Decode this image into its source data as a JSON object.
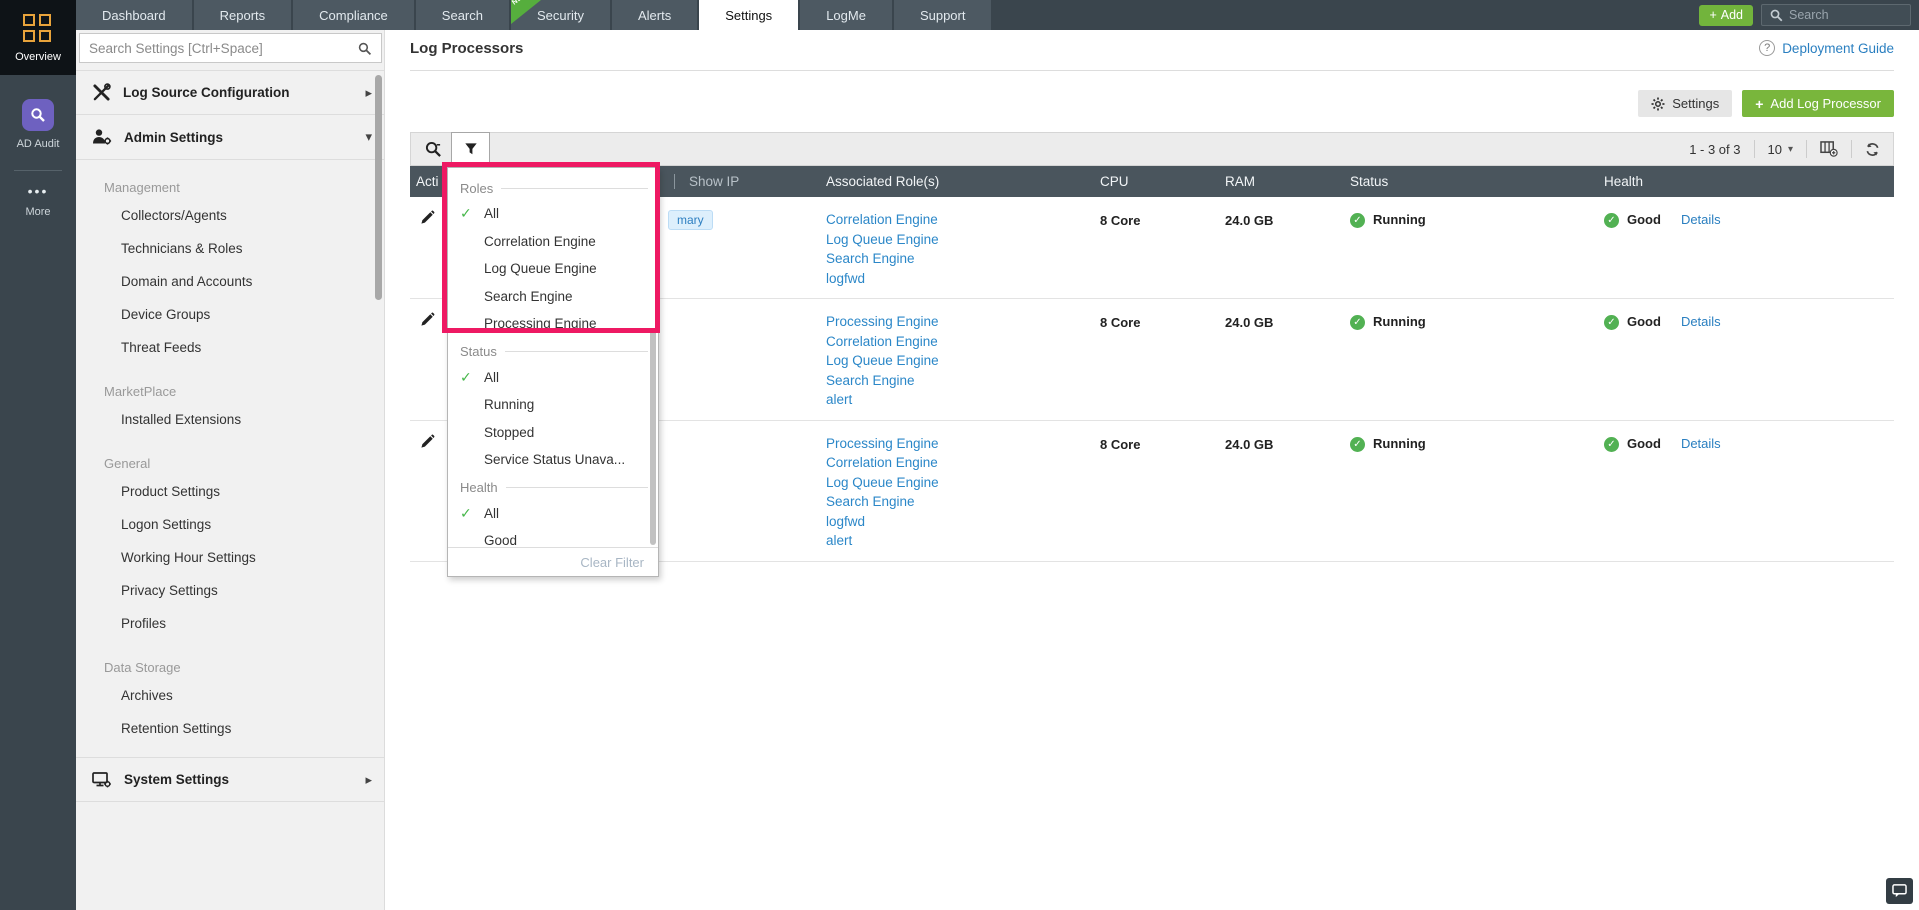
{
  "colors": {
    "accent_green": "#72b43c",
    "link_blue": "#2a7fc0",
    "annotation_pink": "#ee1963",
    "status_green": "#52b153",
    "header_slate": "#4a555d"
  },
  "nav": {
    "tabs": [
      {
        "label": "Dashboard",
        "active": false,
        "badge": ""
      },
      {
        "label": "Reports",
        "active": false,
        "badge": ""
      },
      {
        "label": "Compliance",
        "active": false,
        "badge": ""
      },
      {
        "label": "Search",
        "active": false,
        "badge": ""
      },
      {
        "label": "Security",
        "active": false,
        "badge": "NEW"
      },
      {
        "label": "Alerts",
        "active": false,
        "badge": ""
      },
      {
        "label": "Settings",
        "active": true,
        "badge": ""
      },
      {
        "label": "LogMe",
        "active": false,
        "badge": ""
      },
      {
        "label": "Support",
        "active": false,
        "badge": ""
      }
    ],
    "add_button_label": "Add",
    "add_button_plus": "+",
    "search_placeholder": "Search"
  },
  "rail": {
    "overview_label": "Overview",
    "ad_audit_label": "AD Audit",
    "more_label": "More",
    "more_dots": "•••"
  },
  "sidebar": {
    "search_placeholder": "Search Settings [Ctrl+Space]",
    "log_source_config_label": "Log Source Configuration",
    "admin_settings_label": "Admin Settings",
    "chevron_right": "▸",
    "chevron_down": "▾",
    "sections": [
      {
        "title": "Management",
        "items": [
          "Collectors/Agents",
          "Technicians & Roles",
          "Domain and Accounts",
          "Device Groups",
          "Threat Feeds"
        ]
      },
      {
        "title": "MarketPlace",
        "items": [
          "Installed Extensions"
        ]
      },
      {
        "title": "General",
        "items": [
          "Product Settings",
          "Logon Settings",
          "Working Hour Settings",
          "Privacy Settings",
          "Profiles"
        ]
      },
      {
        "title": "Data Storage",
        "items": [
          "Archives",
          "Retention Settings"
        ]
      }
    ],
    "system_settings_label": "System Settings"
  },
  "main": {
    "title": "Log Processors",
    "deployment_guide_label": "Deployment Guide",
    "question_mark": "?",
    "settings_button_label": "Settings",
    "add_log_processor_label": "Add Log Processor",
    "add_plus": "+",
    "pagination": {
      "range": "1 - 3 of 3",
      "page_size": "10",
      "caret": "▾"
    }
  },
  "table": {
    "headers": {
      "actions": "Acti",
      "show_ip": "Show IP",
      "roles": "Associated Role(s)",
      "cpu": "CPU",
      "ram": "RAM",
      "status": "Status",
      "health": "Health"
    },
    "rows": [
      {
        "badge": "mary",
        "roles": [
          "Correlation Engine",
          "Log Queue Engine",
          "Search Engine",
          "logfwd"
        ],
        "cpu": "8 Core",
        "ram": "24.0 GB",
        "status": "Running",
        "health": "Good",
        "details": "Details"
      },
      {
        "badge": "",
        "roles": [
          "Processing Engine",
          "Correlation Engine",
          "Log Queue Engine",
          "Search Engine",
          "alert"
        ],
        "cpu": "8 Core",
        "ram": "24.0 GB",
        "status": "Running",
        "health": "Good",
        "details": "Details"
      },
      {
        "badge": "",
        "roles": [
          "Processing Engine",
          "Correlation Engine",
          "Log Queue Engine",
          "Search Engine",
          "logfwd",
          "alert"
        ],
        "cpu": "8 Core",
        "ram": "24.0 GB",
        "status": "Running",
        "health": "Good",
        "details": "Details"
      }
    ]
  },
  "filter_dropdown": {
    "groups": [
      {
        "title": "Roles",
        "items": [
          {
            "label": "All",
            "checked": true
          },
          {
            "label": "Correlation Engine",
            "checked": false
          },
          {
            "label": "Log Queue Engine",
            "checked": false
          },
          {
            "label": "Search Engine",
            "checked": false
          },
          {
            "label": "Processing Engine",
            "checked": false
          }
        ]
      },
      {
        "title": "Status",
        "items": [
          {
            "label": "All",
            "checked": true
          },
          {
            "label": "Running",
            "checked": false
          },
          {
            "label": "Stopped",
            "checked": false
          },
          {
            "label": "Service Status Unava...",
            "checked": false
          }
        ]
      },
      {
        "title": "Health",
        "items": [
          {
            "label": "All",
            "checked": true
          },
          {
            "label": "Good",
            "checked": false
          }
        ]
      }
    ],
    "check_glyph": "✓",
    "clear_label": "Clear Filter"
  }
}
